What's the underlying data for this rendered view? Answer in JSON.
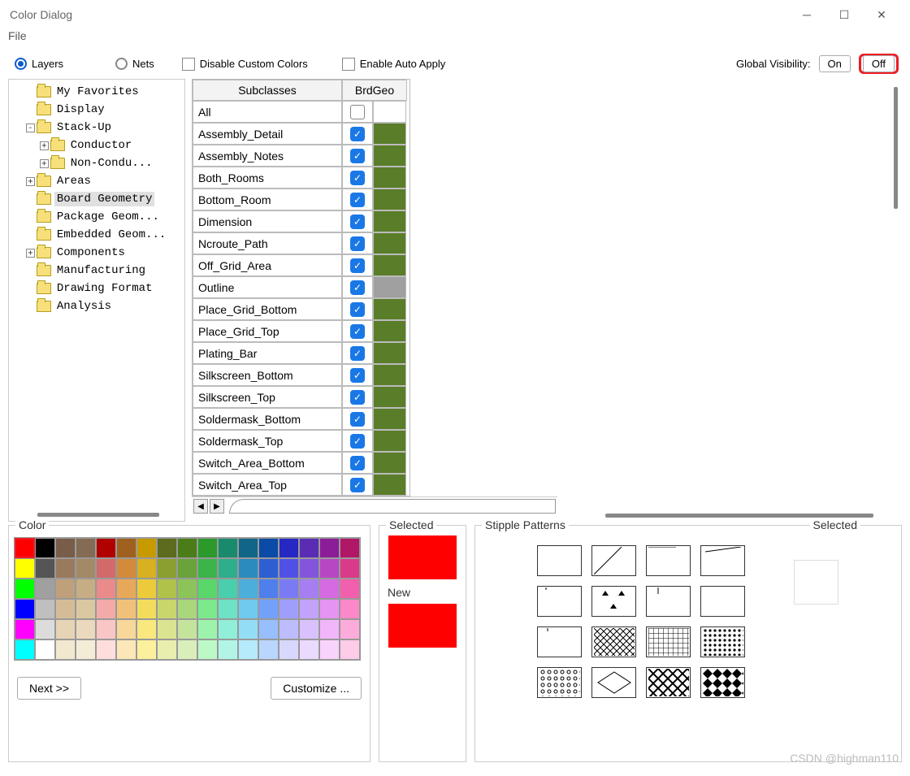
{
  "window": {
    "title": "Color Dialog",
    "menu_file": "File"
  },
  "opts": {
    "layers": "Layers",
    "nets": "Nets",
    "disable_custom": "Disable Custom Colors",
    "enable_auto": "Enable Auto Apply",
    "global_visibility": "Global Visibility:",
    "on": "On",
    "off": "Off"
  },
  "tree": {
    "items": [
      {
        "indent": 1,
        "expander": "",
        "label": "My Favorites"
      },
      {
        "indent": 1,
        "expander": "",
        "label": "Display"
      },
      {
        "indent": 1,
        "expander": "-",
        "label": "Stack-Up"
      },
      {
        "indent": 2,
        "expander": "+",
        "label": "Conductor"
      },
      {
        "indent": 2,
        "expander": "+",
        "label": "Non-Condu..."
      },
      {
        "indent": 1,
        "expander": "+",
        "label": "Areas"
      },
      {
        "indent": 1,
        "expander": "",
        "label": "Board Geometry",
        "selected": true
      },
      {
        "indent": 1,
        "expander": "",
        "label": "Package Geom..."
      },
      {
        "indent": 1,
        "expander": "",
        "label": "Embedded Geom..."
      },
      {
        "indent": 1,
        "expander": "+",
        "label": "Components"
      },
      {
        "indent": 1,
        "expander": "",
        "label": "Manufacturing"
      },
      {
        "indent": 1,
        "expander": "",
        "label": "Drawing Format"
      },
      {
        "indent": 1,
        "expander": "",
        "label": "Analysis"
      }
    ]
  },
  "grid": {
    "header_subclasses": "Subclasses",
    "header_brdgeo": "BrdGeo",
    "rows": [
      {
        "name": "All",
        "checked": "empty",
        "color": ""
      },
      {
        "name": "Assembly_Detail",
        "checked": "on",
        "color": "green"
      },
      {
        "name": "Assembly_Notes",
        "checked": "on",
        "color": "green"
      },
      {
        "name": "Both_Rooms",
        "checked": "on",
        "color": "green"
      },
      {
        "name": "Bottom_Room",
        "checked": "on",
        "color": "green"
      },
      {
        "name": "Dimension",
        "checked": "on",
        "color": "green"
      },
      {
        "name": "Ncroute_Path",
        "checked": "on",
        "color": "green"
      },
      {
        "name": "Off_Grid_Area",
        "checked": "on",
        "color": "green"
      },
      {
        "name": "Outline",
        "checked": "on",
        "color": "gray"
      },
      {
        "name": "Place_Grid_Bottom",
        "checked": "on",
        "color": "green"
      },
      {
        "name": "Place_Grid_Top",
        "checked": "on",
        "color": "green"
      },
      {
        "name": "Plating_Bar",
        "checked": "on",
        "color": "green"
      },
      {
        "name": "Silkscreen_Bottom",
        "checked": "on",
        "color": "green"
      },
      {
        "name": "Silkscreen_Top",
        "checked": "on",
        "color": "green"
      },
      {
        "name": "Soldermask_Bottom",
        "checked": "on",
        "color": "green"
      },
      {
        "name": "Soldermask_Top",
        "checked": "on",
        "color": "green"
      },
      {
        "name": "Switch_Area_Bottom",
        "checked": "on",
        "color": "green"
      },
      {
        "name": "Switch_Area_Top",
        "checked": "on",
        "color": "green"
      }
    ]
  },
  "color_panel": {
    "title": "Color",
    "next": "Next >>",
    "customize": "Customize ...",
    "palette": [
      [
        "#ff0000",
        "#000000",
        "#7a5c4a",
        "#846b53",
        "#b00000",
        "#a06020",
        "#c79a00",
        "#5d6b1e",
        "#4a7d18",
        "#2b9a2b",
        "#1a8a6d",
        "#116688",
        "#0b4aa6",
        "#2727c4",
        "#5a2bb3",
        "#8c1d98",
        "#b01766"
      ],
      [
        "#ffff00",
        "#555555",
        "#9a7a5d",
        "#a38966",
        "#d36a6a",
        "#d48a3b",
        "#d8b020",
        "#8b9e30",
        "#6aa33a",
        "#3cb44a",
        "#2fae8c",
        "#2b8bbf",
        "#2d5fd3",
        "#5050e6",
        "#8355dd",
        "#b847c4",
        "#d93a8a"
      ],
      [
        "#00ff00",
        "#a0a0a0",
        "#bfa07a",
        "#c6ad83",
        "#ea8a8a",
        "#e8a85a",
        "#ebcb3a",
        "#b0c24a",
        "#8cc45a",
        "#59d76a",
        "#49cfab",
        "#4caedb",
        "#4f7fec",
        "#7a7af5",
        "#a77df2",
        "#d56ae2",
        "#f25fad"
      ],
      [
        "#0000ff",
        "#bfbfbf",
        "#d6bc96",
        "#dac8a0",
        "#f4aaa9",
        "#f1c179",
        "#f3dc5b",
        "#c8d66c",
        "#aad67c",
        "#7be98c",
        "#6ee2c5",
        "#70c9ee",
        "#73a1fa",
        "#9f9ffb",
        "#c3a2fb",
        "#e694f3",
        "#fb88c8"
      ],
      [
        "#ff00ff",
        "#dcdcdc",
        "#e6d4b5",
        "#ead9bc",
        "#fac6c5",
        "#f7d79a",
        "#f8e87d",
        "#dbe490",
        "#c4e49c",
        "#9df3ab",
        "#91eed8",
        "#94ddf7",
        "#98befd",
        "#bdbdfe",
        "#d9c1fd",
        "#f1b6f9",
        "#fdabdb"
      ],
      [
        "#00ffff",
        "#ffffff",
        "#f2e8d0",
        "#f3ecd7",
        "#fddedd",
        "#fce7b9",
        "#fcf09d",
        "#e9eeaf",
        "#d9eeba",
        "#bdf8c7",
        "#b2f5e6",
        "#b5ebfb",
        "#bad6fe",
        "#d8d8fe",
        "#e9dafe",
        "#f8d3fc",
        "#fecbe9"
      ]
    ]
  },
  "selected_panel": {
    "title": "Selected",
    "new": "New"
  },
  "stipple_panel": {
    "title": "Stipple Patterns",
    "selected_title": "Selected",
    "patterns": [
      "blank",
      "diag-left",
      "diag-cross",
      "horiz-lines",
      "vert-lines",
      "tri-up",
      "plus",
      "dots-sparse",
      "dash-v",
      "cross-dense",
      "grid",
      "dots-dense",
      "dots-circle",
      "diamond",
      "x-big",
      "check"
    ]
  },
  "watermark": "CSDN @highman110"
}
